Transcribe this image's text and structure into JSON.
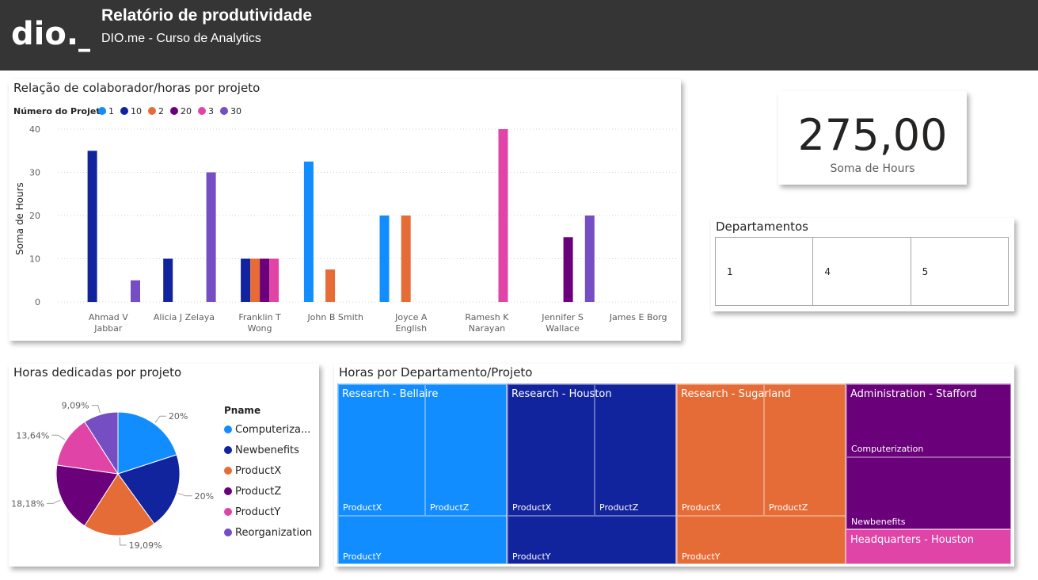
{
  "header": {
    "logo_text": "dio._",
    "title": "Relatório de produtividade",
    "subtitle": "DIO.me - Curso de Analytics"
  },
  "colors": {
    "header_bg": "#353535",
    "proj_1": "#118DFF",
    "proj_10": "#12239E",
    "proj_2": "#E66C37",
    "proj_20": "#6B007B",
    "proj_3": "#E044A7",
    "proj_30": "#744EC2"
  },
  "bar_chart": {
    "title": "Relação de colaborador/horas por projeto",
    "legend_title": "Número do Projeto",
    "ylabel": "Soma de Hours",
    "yticks": [
      "0",
      "10",
      "20",
      "30",
      "40"
    ],
    "employees": [
      {
        "line1": "Ahmad V",
        "line2": "Jabbar"
      },
      {
        "line1": "Alicia J Zelaya",
        "line2": ""
      },
      {
        "line1": "Franklin T",
        "line2": "Wong"
      },
      {
        "line1": "John B Smith",
        "line2": ""
      },
      {
        "line1": "Joyce A",
        "line2": "English"
      },
      {
        "line1": "Ramesh K",
        "line2": "Narayan"
      },
      {
        "line1": "Jennifer S",
        "line2": "Wallace"
      },
      {
        "line1": "James E Borg",
        "line2": ""
      }
    ]
  },
  "chart_data": [
    {
      "type": "bar",
      "title": "Relação de colaborador/horas por projeto",
      "xlabel": "",
      "ylabel": "Soma de Hours",
      "ylim": [
        0,
        40
      ],
      "grid": true,
      "legend_placement": "top-left",
      "categories": [
        "Ahmad V Jabbar",
        "Alicia J Zelaya",
        "Franklin T Wong",
        "John B Smith",
        "Joyce A English",
        "Ramesh K Narayan",
        "Jennifer S Wallace",
        "James E Borg"
      ],
      "series": [
        {
          "name": "1",
          "values": [
            null,
            null,
            null,
            32.5,
            20,
            null,
            null,
            null
          ]
        },
        {
          "name": "10",
          "values": [
            35,
            10,
            10,
            null,
            null,
            null,
            null,
            null
          ]
        },
        {
          "name": "2",
          "values": [
            null,
            null,
            10,
            7.5,
            20,
            null,
            null,
            null
          ]
        },
        {
          "name": "20",
          "values": [
            null,
            null,
            10,
            null,
            null,
            null,
            15,
            null
          ]
        },
        {
          "name": "3",
          "values": [
            null,
            null,
            10,
            null,
            null,
            40,
            null,
            null
          ]
        },
        {
          "name": "30",
          "values": [
            5,
            30,
            null,
            null,
            null,
            null,
            20,
            null
          ]
        }
      ]
    },
    {
      "type": "pie",
      "title": "Horas dedicadas por projeto",
      "legend_title": "Pname",
      "legend_placement": "right",
      "categories": [
        "Computerization",
        "Newbenefits",
        "ProductX",
        "ProductZ",
        "ProductY",
        "Reorganization"
      ],
      "legend_labels": [
        "Computeriza...",
        "Newbenefits",
        "ProductX",
        "ProductZ",
        "ProductY",
        "Reorganization"
      ],
      "values": [
        20,
        20,
        19.09,
        18.18,
        13.64,
        9.09
      ],
      "data_labels": [
        "20%",
        "20%",
        "19,09%",
        "18,18%",
        "13,64%",
        "9,09%"
      ]
    },
    {
      "type": "treemap",
      "title": "Horas por Departamento/Projeto",
      "groups": [
        {
          "name": "Research - Bellaire",
          "children": [
            "ProductX",
            "ProductZ",
            "ProductY"
          ]
        },
        {
          "name": "Research - Houston",
          "children": [
            "ProductX",
            "ProductZ",
            "ProductY"
          ]
        },
        {
          "name": "Research - Sugarland",
          "children": [
            "ProductX",
            "ProductZ",
            "ProductY"
          ]
        },
        {
          "name": "Administration - Stafford",
          "children": [
            "Computerization",
            "Newbenefits"
          ]
        },
        {
          "name": "Headquarters - Houston",
          "children": []
        }
      ]
    }
  ],
  "kpi": {
    "value": "275,00",
    "label": "Soma de Hours"
  },
  "departments": {
    "title": "Departamentos",
    "values": [
      "1",
      "4",
      "5"
    ]
  },
  "pie": {
    "title": "Horas dedicadas por projeto"
  },
  "treemap": {
    "title": "Horas por Departamento/Projeto"
  }
}
